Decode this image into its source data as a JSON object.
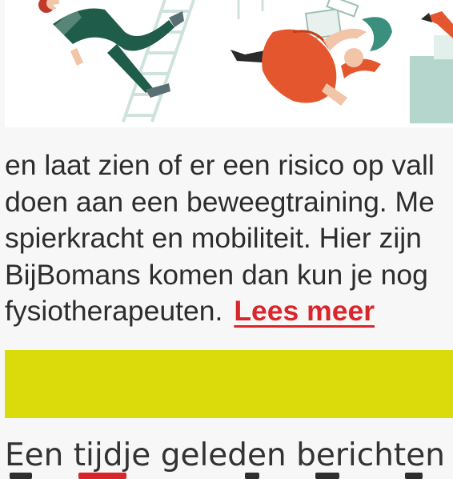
{
  "article": {
    "lines": [
      "en laat zien of er een risico op vall",
      "doen aan een beweegtraining. Me",
      "spierkracht en mobiliteit. Hier zijn",
      "BijBomans komen dan kun je nog"
    ],
    "last_line": "fysiotherapeuten.",
    "read_more": "Lees meer"
  },
  "next_section": {
    "heading": "Een tijdje geleden berichten"
  },
  "colors": {
    "banner": "#dbdb0c",
    "link": "#d8262b",
    "figure_green": "#1f5c4a",
    "figure_red": "#e4572e"
  }
}
